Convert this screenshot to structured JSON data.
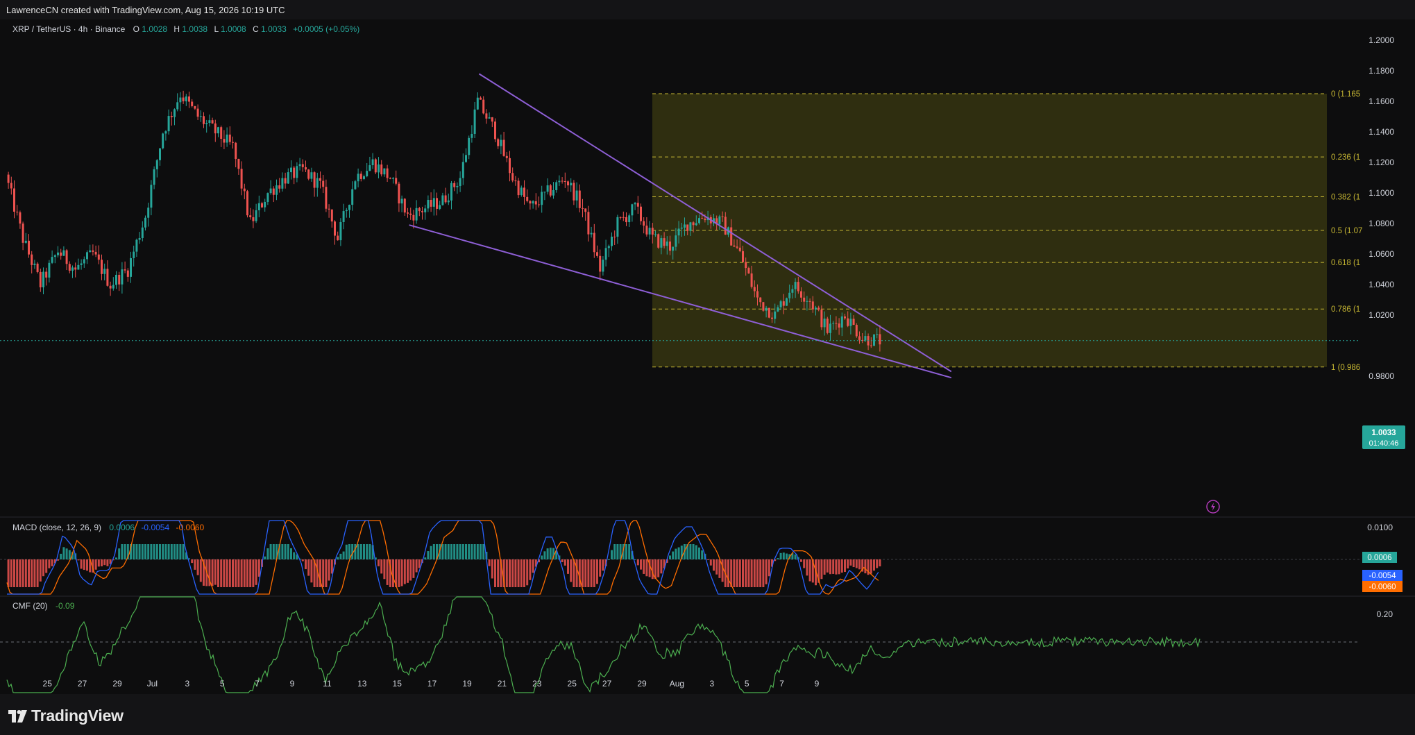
{
  "header": {
    "attribution": "LawrenceCN created with TradingView.com, Aug 15, 2026 10:19 UTC"
  },
  "legend": {
    "symbol": "XRP / TetherUS · 4h · Binance",
    "o_label": "O",
    "o": "1.0028",
    "h_label": "H",
    "h": "1.0038",
    "l_label": "L",
    "l": "1.0008",
    "c_label": "C",
    "c": "1.0033",
    "change": "+0.0005 (+0.05%)"
  },
  "price_badge": {
    "price": "1.0033",
    "countdown": "01:40:46"
  },
  "macd_legend": {
    "name": "MACD (close, 12, 26, 9)",
    "v1": "0.0006",
    "v2": "-0.0054",
    "v3": "-0.0060"
  },
  "cmf_legend": {
    "name": "CMF (20)",
    "v": "-0.09"
  },
  "footer": {
    "brand": "TradingView"
  },
  "colors": {
    "up": "#26a69a",
    "down": "#ef5350",
    "wedge": "#8e5fd6",
    "fib_fill": "#3b3a12",
    "fib_line": "#c8b833",
    "macd_line": "#2962ff",
    "signal_line": "#ff6d00",
    "cmf_line": "#4caf50"
  },
  "chart_data": [
    {
      "type": "candlestick",
      "title": "XRP / TetherUS · 4h · Binance",
      "y_ticks": [
        "1.2000",
        "1.1800",
        "1.1600",
        "1.1400",
        "1.1200",
        "1.1000",
        "1.0800",
        "1.0600",
        "1.0400",
        "1.0200",
        "0.9800"
      ],
      "ylim": [
        0.97,
        1.205
      ],
      "x_ticks": [
        "25",
        "27",
        "29",
        "Jul",
        "3",
        "5",
        "7",
        "9",
        "11",
        "13",
        "15",
        "17",
        "19",
        "21",
        "23",
        "25",
        "27",
        "29",
        "Aug",
        "3",
        "5",
        "7",
        "9"
      ],
      "price_anchors": [
        {
          "t": "Jun 24",
          "v": 1.112
        },
        {
          "t": "Jun 25",
          "v": 1.07
        },
        {
          "t": "Jun 26",
          "v": 1.04
        },
        {
          "t": "Jun 27",
          "v": 1.062
        },
        {
          "t": "Jun 28",
          "v": 1.05
        },
        {
          "t": "Jun 29",
          "v": 1.06
        },
        {
          "t": "Jun 30",
          "v": 1.04
        },
        {
          "t": "Jul 1",
          "v": 1.05
        },
        {
          "t": "Jul 2",
          "v": 1.085
        },
        {
          "t": "Jul 3",
          "v": 1.14
        },
        {
          "t": "Jul 4",
          "v": 1.165
        },
        {
          "t": "Jul 5",
          "v": 1.15
        },
        {
          "t": "Jul 6",
          "v": 1.14
        },
        {
          "t": "Jul 7",
          "v": 1.13
        },
        {
          "t": "Jul 8",
          "v": 1.08
        },
        {
          "t": "Jul 9",
          "v": 1.1
        },
        {
          "t": "Jul 10",
          "v": 1.11
        },
        {
          "t": "Jul 11",
          "v": 1.115
        },
        {
          "t": "Jul 12",
          "v": 1.105
        },
        {
          "t": "Jul 13",
          "v": 1.07
        },
        {
          "t": "Jul 14",
          "v": 1.11
        },
        {
          "t": "Jul 15",
          "v": 1.12
        },
        {
          "t": "Jul 16",
          "v": 1.11
        },
        {
          "t": "Jul 17",
          "v": 1.085
        },
        {
          "t": "Jul 18",
          "v": 1.09
        },
        {
          "t": "Jul 19",
          "v": 1.095
        },
        {
          "t": "Jul 20",
          "v": 1.11
        },
        {
          "t": "Jul 21",
          "v": 1.16
        },
        {
          "t": "Jul 22",
          "v": 1.14
        },
        {
          "t": "Jul 23",
          "v": 1.11
        },
        {
          "t": "Jul 24",
          "v": 1.09
        },
        {
          "t": "Jul 25",
          "v": 1.1
        },
        {
          "t": "Jul 26",
          "v": 1.11
        },
        {
          "t": "Jul 27",
          "v": 1.09
        },
        {
          "t": "Jul 28",
          "v": 1.05
        },
        {
          "t": "Jul 29",
          "v": 1.08
        },
        {
          "t": "Jul 30",
          "v": 1.09
        },
        {
          "t": "Jul 31",
          "v": 1.07
        },
        {
          "t": "Aug 1",
          "v": 1.065
        },
        {
          "t": "Aug 2",
          "v": 1.08
        },
        {
          "t": "Aug 3",
          "v": 1.085
        },
        {
          "t": "Aug 4",
          "v": 1.08
        },
        {
          "t": "Aug 5",
          "v": 1.06
        },
        {
          "t": "Aug 6",
          "v": 1.03
        },
        {
          "t": "Aug 7",
          "v": 1.02
        },
        {
          "t": "Aug 8",
          "v": 1.04
        },
        {
          "t": "Aug 9",
          "v": 1.03
        },
        {
          "t": "Aug 10",
          "v": 1.01
        },
        {
          "t": "Aug 11",
          "v": 1.02
        },
        {
          "t": "Aug 12",
          "v": 1.005
        },
        {
          "t": "Aug 13",
          "v": 1.0033
        }
      ],
      "fibonacci": [
        {
          "level": "0",
          "label": "0 (1.165",
          "price": 1.165
        },
        {
          "level": "0.236",
          "label": "0.236 (1",
          "price": 1.1236
        },
        {
          "level": "0.382",
          "label": "0.382 (1",
          "price": 1.0975
        },
        {
          "level": "0.5",
          "label": "0.5 (1.07",
          "price": 1.0755
        },
        {
          "level": "0.618",
          "label": "0.618 (1",
          "price": 1.0545
        },
        {
          "level": "0.786",
          "label": "0.786 (1",
          "price": 1.024
        },
        {
          "level": "1",
          "label": "1 (0.986",
          "price": 0.986
        }
      ],
      "wedge_upper": [
        {
          "t": "Jul 21",
          "v": 1.178
        },
        {
          "t": "Aug 17",
          "v": 0.983
        }
      ],
      "wedge_lower": [
        {
          "t": "Jul 17",
          "v": 1.079
        },
        {
          "t": "Aug 17",
          "v": 0.979
        }
      ]
    },
    {
      "type": "bar",
      "title": "MACD (close, 12, 26, 9)",
      "y_ticks": [
        "0.0100"
      ],
      "values_latest": {
        "histogram": 0.0006,
        "macd": -0.0054,
        "signal": -0.006
      }
    },
    {
      "type": "line",
      "title": "CMF (20)",
      "y_ticks": [
        "0.20"
      ],
      "values_latest": {
        "cmf": -0.09
      }
    }
  ]
}
